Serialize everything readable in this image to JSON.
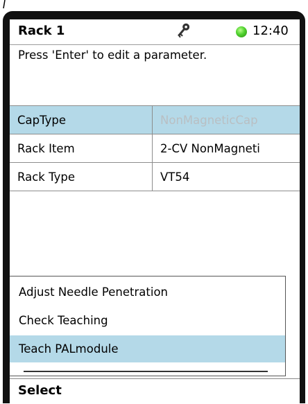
{
  "header": {
    "title": "Rack 1",
    "time": "12:40",
    "status_color": "#4fd12e",
    "icons": [
      "key-icon",
      "status-led-icon"
    ]
  },
  "hint": "Press 'Enter' to edit a parameter.",
  "params": [
    {
      "name": "CapType",
      "value": "NonMagneticCap",
      "selected": true,
      "value_disabled": true
    },
    {
      "name": "Rack Item",
      "value": "2-CV NonMagneti",
      "selected": false
    },
    {
      "name": "Rack Type",
      "value": "VT54",
      "selected": false
    }
  ],
  "menu": {
    "items": [
      {
        "label": "Adjust Needle Penetration",
        "selected": false
      },
      {
        "label": "Check Teaching",
        "selected": false
      },
      {
        "label": "Teach PALmodule",
        "selected": true
      }
    ]
  },
  "softkey": {
    "label": "Select"
  },
  "colors": {
    "selection": "#b4d9e8",
    "disabled_text": "#b9bfc3",
    "frame": "#111111"
  }
}
